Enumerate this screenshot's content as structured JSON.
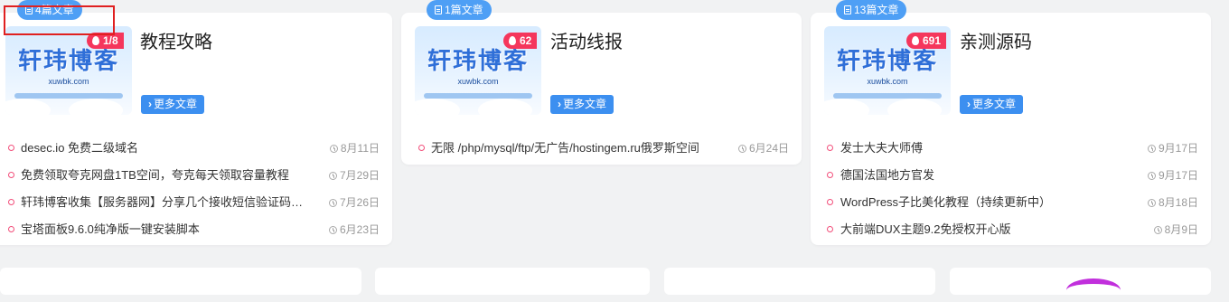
{
  "categories": [
    {
      "count_label": "4篇文章",
      "hot": "1/8",
      "title": "教程攻略",
      "more": "更多文章",
      "thumb_logo": "轩玮博客",
      "thumb_sub": "xuwbk.com",
      "posts": [
        {
          "title": "desec.io 免费二级域名",
          "date": "8月11日"
        },
        {
          "title": "免费领取夸克网盘1TB空间，夸克每天领取容量教程",
          "date": "7月29日"
        },
        {
          "title": "轩玮博客收集【服务器网】分享几个接收短信验证码的网站",
          "date": "7月26日"
        },
        {
          "title": "宝塔面板9.6.0纯净版一键安装脚本",
          "date": "6月23日"
        }
      ]
    },
    {
      "count_label": "1篇文章",
      "hot": "62",
      "title": "活动线报",
      "more": "更多文章",
      "thumb_logo": "轩玮博客",
      "thumb_sub": "xuwbk.com",
      "posts": [
        {
          "title": "无限 /php/mysql/ftp/无广告/hostingem.ru俄罗斯空间",
          "date": "6月24日"
        }
      ]
    },
    {
      "count_label": "13篇文章",
      "hot": "691",
      "title": "亲测源码",
      "more": "更多文章",
      "thumb_logo": "轩玮博客",
      "thumb_sub": "xuwbk.com",
      "posts": [
        {
          "title": "发士大夫大师傅",
          "date": "9月17日"
        },
        {
          "title": "德国法国地方官发",
          "date": "9月17日"
        },
        {
          "title": "WordPress子比美化教程（持续更新中）",
          "date": "8月18日"
        },
        {
          "title": "大前端DUX主题9.2免授权开心版",
          "date": "8月9日"
        }
      ]
    }
  ],
  "colors": {
    "accent_blue": "#3c8ff0",
    "badge_blue": "#4e9ff5",
    "hot_red": "#f5365c",
    "dot_pink": "#f24e7a",
    "annotation_red": "#e02020"
  }
}
